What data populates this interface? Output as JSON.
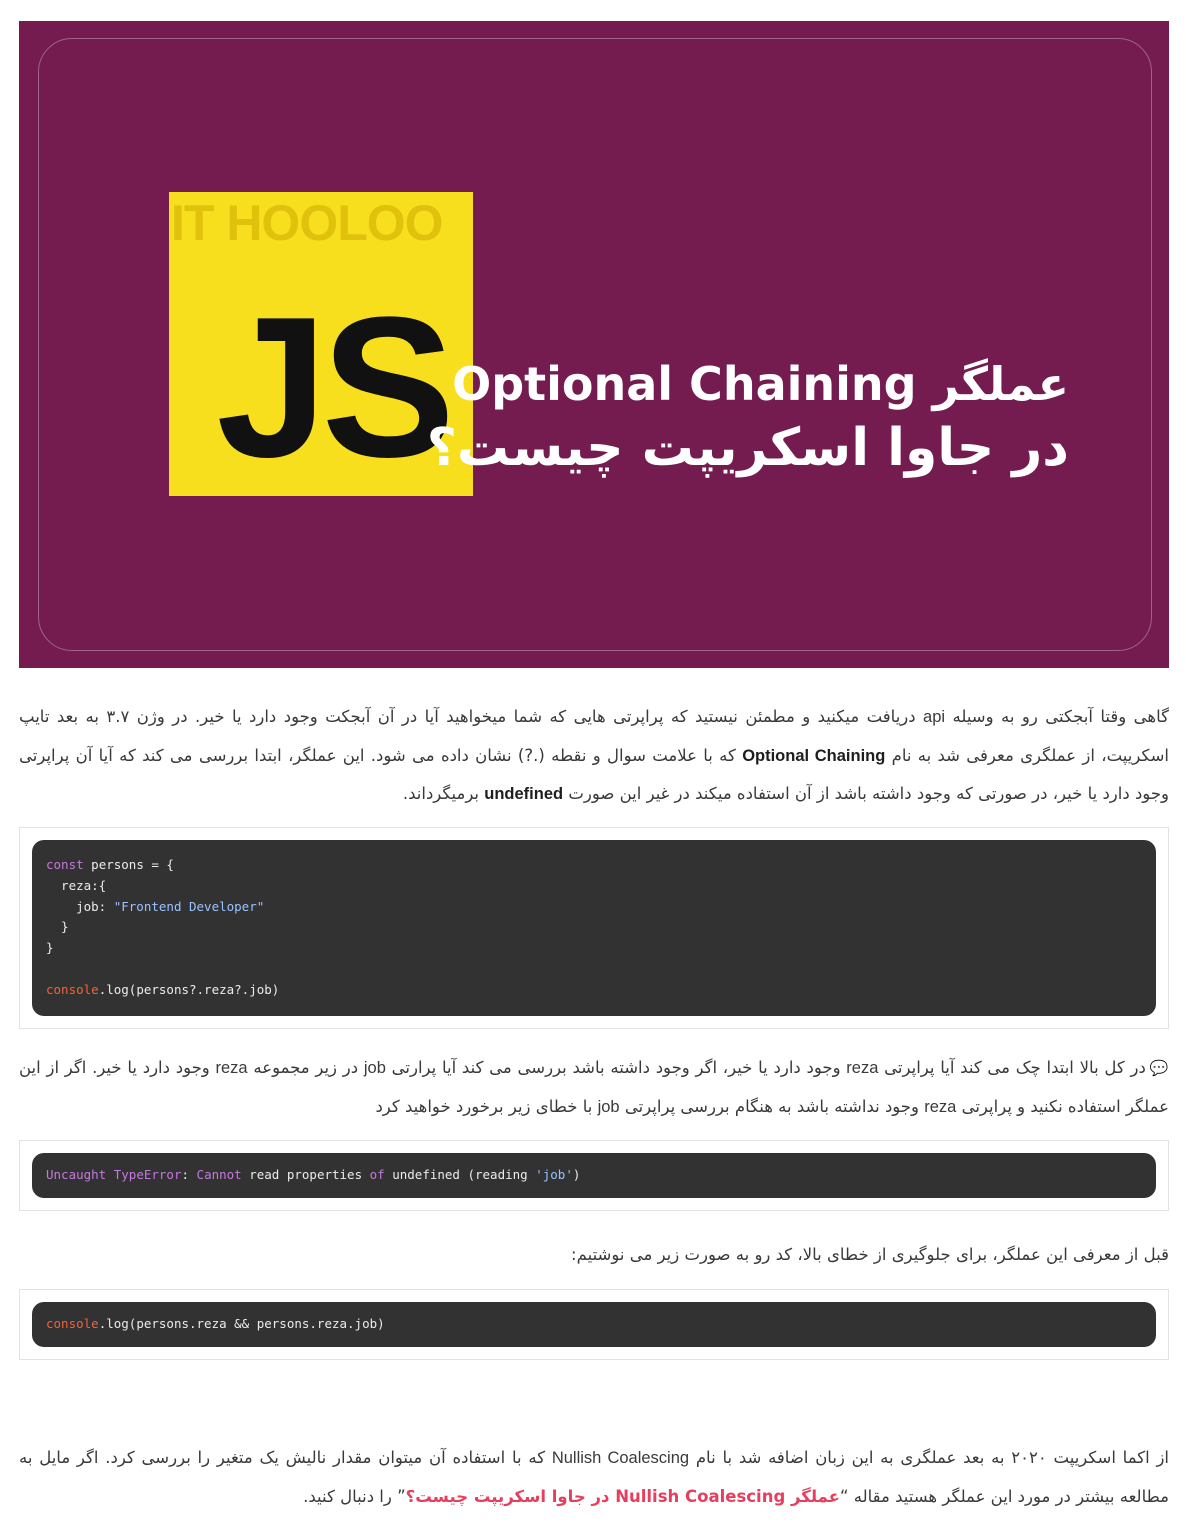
{
  "hero": {
    "watermark": "IT HOOLOO",
    "logo_text": "JS",
    "title_line1": "عملگر Optional Chaining",
    "title_line2": "در جاوا اسکریپت چیست؟",
    "colors": {
      "background": "#741b4f",
      "logo": "#f7df1e"
    }
  },
  "intro": {
    "part1": "گاهی وقتا آبجکتی رو به وسیله ",
    "api": "api",
    "part2": " دریافت میکنید و مطمئن نیستید که پراپرتی هایی که شما میخواهید آیا در آن آبجکت وجود دارد یا خیر. در وژن ۳.۷ به بعد تایپ اسکریپت، از عملگری معرفی شد به نام ",
    "term": "Optional Chaining",
    "part3": " که با علامت سوال و نقطه (.?) نشان داده می شود. این عملگر، ابتدا بررسی می کند که آیا آن پراپرتی وجود دارد یا خیر، در صورتی که وجود داشته باشد از آن استفاده میکند در غیر این صورت ",
    "undefined": "undefined",
    "part4": " برمیگرداند."
  },
  "code1": {
    "l1_kw": "const",
    "l1_rest": " persons = {",
    "l2": "  reza:{",
    "l3_key": "    job: ",
    "l3_str": "\"Frontend Developer\"",
    "l4": "  }",
    "l5": "}",
    "l7_obj": "console",
    "l7_rest": ".log(persons?.reza?.job)"
  },
  "explain": {
    "icon": "comment-icon",
    "part1": "در کل بالا ابتدا چک می کند آیا پراپرتی ",
    "reza1": "reza",
    "part2": " وجود دارد یا خیر، اگر وجود داشته باشد بررسی می کند آیا پرارتی ",
    "job1": "job",
    "part3": " در زیر مجموعه ",
    "reza2": "reza",
    "part4": " وجود دارد یا خیر. اگر از این عملگر استفاده نکنید و پراپرتی ",
    "reza3": "reza",
    "part5": " وجود نداشته باشد به هنگام بررسی پراپرتی ",
    "job2": "job",
    "part6": " با خطای زیر برخورد خواهید کرد"
  },
  "code2": {
    "k1": "Uncaught",
    "k2": "TypeError",
    "colon": ":",
    "k3": "Cannot",
    "t1": " read properties ",
    "k4": "of",
    "t2": " undefined (reading ",
    "s1": "'job'",
    "t3": ")"
  },
  "before": {
    "text": "قبل از معرفی این عملگر، برای جلوگیری از خطای بالا، کد رو به صورت زیر می نوشتیم:"
  },
  "code3": {
    "obj": "console",
    "rest": ".log(persons.reza && persons.reza.job)"
  },
  "outro": {
    "part1": "از اکما اسکریپت ۲۰۲۰ به بعد عملگری به این زبان اضافه شد با نام ",
    "term": "Nullish Coalescing",
    "part2": " که با استفاده آن میتوان مقدار نالیش یک متغیر را بررسی کرد. اگر مایل به مطالعه بیشتر در مورد این عملگر هستید مقاله “",
    "link": "عملگر Nullish Coalescing در جاوا اسکریپت چیست؟",
    "part3": "” را دنبال کنید."
  }
}
